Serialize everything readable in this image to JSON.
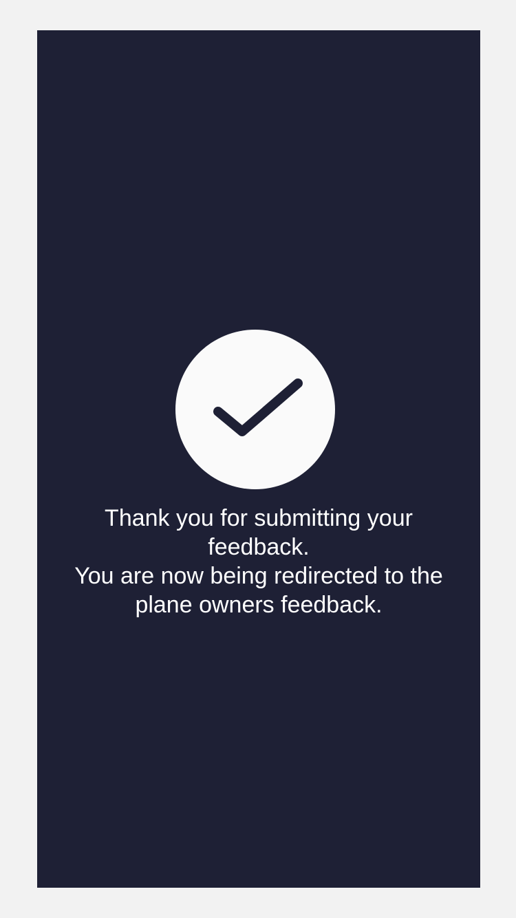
{
  "colors": {
    "page_background": "#f2f2f2",
    "panel_background": "#1e2035",
    "check_circle": "#fafafa",
    "check_mark": "#1e2035",
    "text": "#ffffff"
  },
  "icon": {
    "name": "checkmark-icon"
  },
  "message": {
    "line1": "Thank you for submitting your feedback.",
    "line2": "You are now being redirected to the plane owners feedback."
  }
}
